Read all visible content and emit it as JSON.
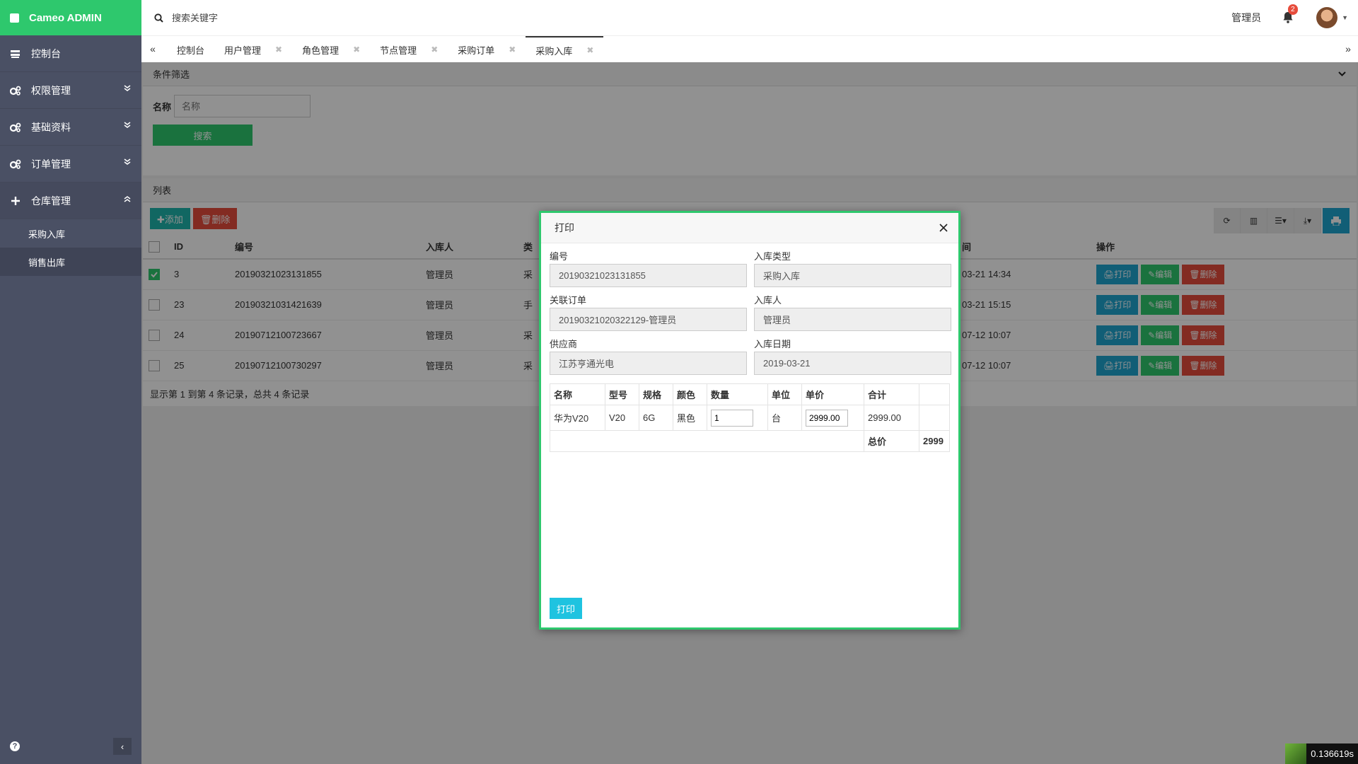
{
  "brand": "Cameo ADMIN",
  "sidebar": {
    "items": [
      {
        "label": "控制台"
      },
      {
        "label": "权限管理"
      },
      {
        "label": "基础资料"
      },
      {
        "label": "订单管理"
      },
      {
        "label": "仓库管理"
      }
    ],
    "sub_items": [
      {
        "label": "采购入库"
      },
      {
        "label": "销售出库"
      }
    ],
    "collapse_glyph": "‹",
    "help_glyph": "?"
  },
  "topbar": {
    "search_placeholder": "搜索关键字",
    "user": "管理员",
    "notifications": "2"
  },
  "tabs": {
    "left_arrow": "«",
    "right_arrow": "»",
    "items": [
      {
        "label": "控制台"
      },
      {
        "label": "用户管理"
      },
      {
        "label": "角色管理"
      },
      {
        "label": "节点管理"
      },
      {
        "label": "采购订单"
      },
      {
        "label": "采购入库"
      }
    ],
    "close_glyph": "✖"
  },
  "filter": {
    "title": "条件筛选",
    "name_label": "名称",
    "name_placeholder": "名称",
    "search_button": "搜索"
  },
  "list": {
    "title": "列表",
    "add_button": "✚添加",
    "delete_button": "🗑删除",
    "columns": [
      "ID",
      "编号",
      "入库人",
      "类",
      "间",
      "操作"
    ],
    "rows": [
      {
        "id": "3",
        "code": "20190321023131855",
        "person": "管理员",
        "type": "采",
        "time": "03-21 14:34",
        "checked": true
      },
      {
        "id": "23",
        "code": "20190321031421639",
        "person": "管理员",
        "type": "手",
        "time": "03-21 15:15",
        "checked": false
      },
      {
        "id": "24",
        "code": "20190712100723667",
        "person": "管理员",
        "type": "采",
        "time": "07-12 10:07",
        "checked": false
      },
      {
        "id": "25",
        "code": "20190712100730297",
        "person": "管理员",
        "type": "采",
        "time": "07-12 10:07",
        "checked": false
      }
    ],
    "op_print": "🖨打印",
    "op_edit": "✎编辑",
    "op_delete": "🗑删除",
    "footer": "显示第 1 到第 4 条记录，总共 4 条记录"
  },
  "modal": {
    "title": "打印",
    "fields": {
      "code_label": "编号",
      "code_value": "20190321023131855",
      "type_label": "入库类型",
      "type_value": "采购入库",
      "order_label": "关联订单",
      "order_value": "20190321020322129-管理员",
      "person_label": "入库人",
      "person_value": "管理员",
      "supplier_label": "供应商",
      "supplier_value": "江苏亨通光电",
      "date_label": "入库日期",
      "date_value": "2019-03-21"
    },
    "items": {
      "columns": [
        "名称",
        "型号",
        "规格",
        "颜色",
        "数量",
        "单位",
        "单价",
        "合计"
      ],
      "row": {
        "name": "华为V20",
        "model": "V20",
        "spec": "6G",
        "color": "黑色",
        "qty": "1",
        "unit": "台",
        "price": "2999.00",
        "subtotal": "2999.00"
      },
      "total_label": "总价",
      "total_value": "2999"
    },
    "print_button": "打印"
  },
  "timer": "0.136619s",
  "colors": {
    "brand_green": "#2ec86d",
    "sidebar_bg": "#4a5064",
    "print_blue": "#1fa5d0",
    "danger_red": "#e74c3c"
  }
}
